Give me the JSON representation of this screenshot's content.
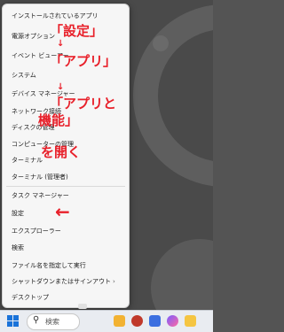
{
  "menu": {
    "items": [
      {
        "label": "インストールされているアプリ",
        "submenu": false
      },
      {
        "label": "電源オプション",
        "submenu": false
      },
      {
        "label": "イベント ビューアー",
        "submenu": false
      },
      {
        "label": "システム",
        "submenu": false
      },
      {
        "label": "デバイス マネージャー",
        "submenu": false
      },
      {
        "label": "ネットワーク接続",
        "submenu": false
      },
      {
        "label": "ディスクの管理",
        "submenu": false
      },
      {
        "label": "コンピューターの管理",
        "submenu": false
      },
      {
        "label": "ターミナル",
        "submenu": false
      },
      {
        "label": "ターミナル (管理者)",
        "submenu": false
      },
      {
        "label": "タスク マネージャー",
        "submenu": false
      },
      {
        "label": "設定",
        "submenu": false
      },
      {
        "label": "エクスプローラー",
        "submenu": false
      },
      {
        "label": "検索",
        "submenu": false
      },
      {
        "label": "ファイル名を指定して実行",
        "submenu": false
      },
      {
        "label": "シャットダウンまたはサインアウト",
        "submenu": true,
        "arrow": "›"
      },
      {
        "label": "デスクトップ",
        "submenu": false
      }
    ]
  },
  "annotations": {
    "setting": "「設定」",
    "arrow_down": "↓",
    "app": "「アプリ」",
    "app_and": "「アプリと",
    "kinou": "機能」",
    "open": "を開く",
    "left_arrow": "←"
  },
  "taskbar": {
    "search_placeholder": "検索",
    "search_icon": "search-icon",
    "accent": "#1a73d9"
  }
}
